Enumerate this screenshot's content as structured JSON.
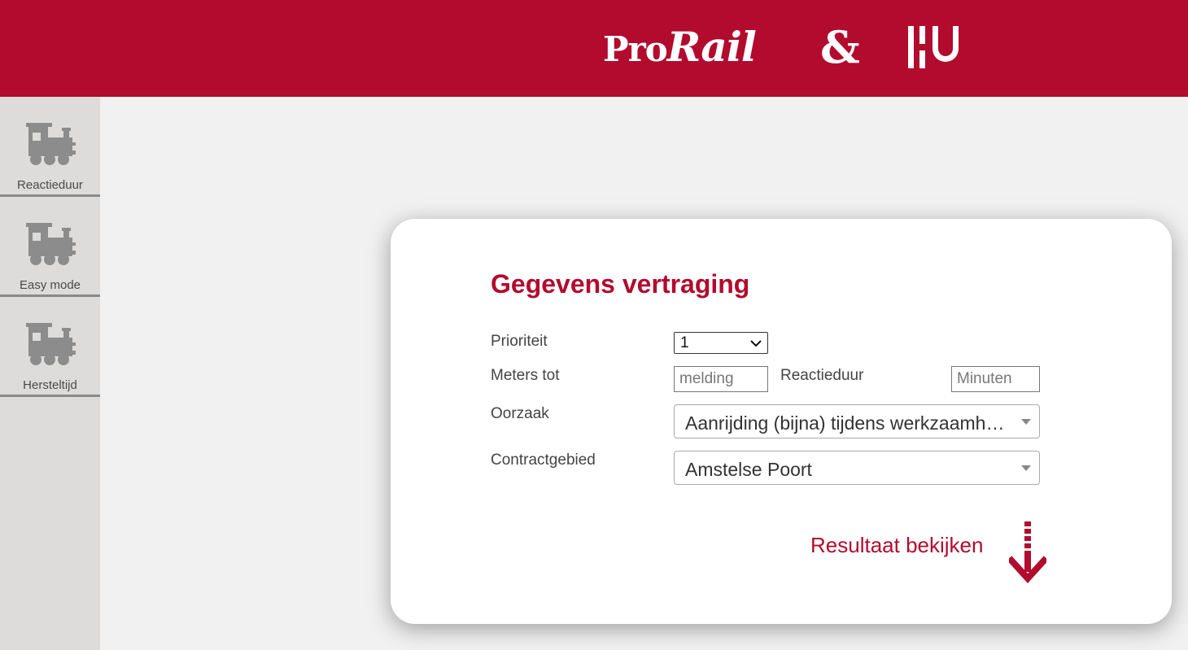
{
  "header": {
    "logo_prorail_pro": "Pro",
    "logo_prorail_rail": "Rail",
    "logo_amp": "&",
    "logo_hu": "HU",
    "brand_color": "#b20b2e"
  },
  "sidebar": {
    "items": [
      {
        "label": "Reactieduur",
        "icon": "train-icon"
      },
      {
        "label": "Easy mode",
        "icon": "train-icon"
      },
      {
        "label": "Hersteltijd",
        "icon": "train-icon"
      }
    ]
  },
  "form": {
    "title": "Gegevens vertraging",
    "prioriteit_label": "Prioriteit",
    "prioriteit_value": "1",
    "meters_label": "Meters tot",
    "meters_placeholder": "melding",
    "reactieduur_label": "Reactieduur",
    "reactieduur_placeholder": "Minuten",
    "oorzaak_label": "Oorzaak",
    "oorzaak_value": "Aanrijding (bijna) tijdens werkzaamheden",
    "contract_label": "Contractgebied",
    "contract_value": "Amstelse Poort",
    "result_label": "Resultaat bekijken"
  }
}
